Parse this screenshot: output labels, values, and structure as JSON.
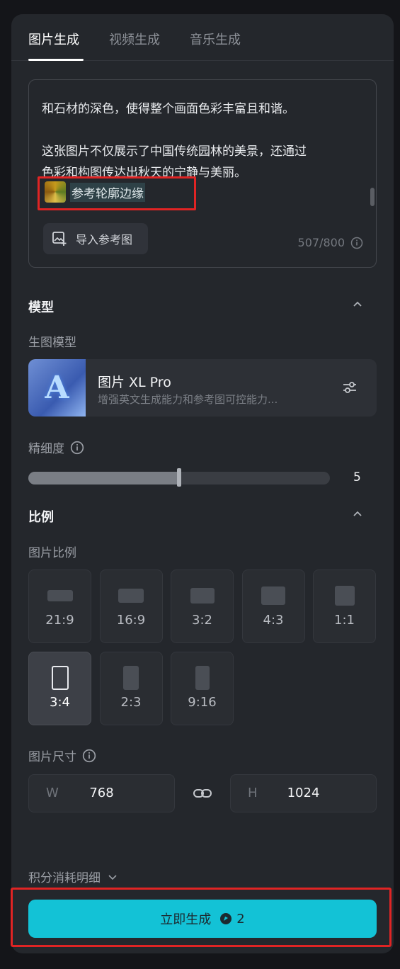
{
  "tabs": [
    {
      "label": "图片生成",
      "active": true
    },
    {
      "label": "视频生成",
      "active": false
    },
    {
      "label": "音乐生成",
      "active": false
    }
  ],
  "prompt": {
    "lines": [
      "和石材的深色，使得整个画面色彩丰富且和谐。",
      "",
      "这张图片不仅展示了中国传统园林的美景，还通过",
      "色彩和构图传达出秋天的宁静与美丽。"
    ],
    "ref_label": "参考轮廓边缘",
    "import_label": "导入参考图",
    "counter": "507/800"
  },
  "model_section": {
    "title": "模型",
    "sub_label": "生图模型",
    "model_name": "图片 XL Pro",
    "model_desc": "增强英文生成能力和参考图可控能力...",
    "thumb_letter": "A",
    "detail_label": "精细度",
    "detail_value": "5",
    "detail_fraction": 0.5
  },
  "ratio_section": {
    "title": "比例",
    "sub_label": "图片比例",
    "ratios": [
      "21:9",
      "16:9",
      "3:2",
      "4:3",
      "1:1",
      "3:4",
      "2:3",
      "9:16"
    ],
    "selected": "3:4",
    "size_label": "图片尺寸",
    "w_key": "W",
    "w_value": "768",
    "h_key": "H",
    "h_value": "1024"
  },
  "cost_label": "积分消耗明细",
  "generate": {
    "label": "立即生成",
    "cost": "2"
  },
  "colors": {
    "accent": "#13c2d6",
    "highlight_box": "#e02424",
    "panel": "#24272c",
    "background": "#141519"
  }
}
